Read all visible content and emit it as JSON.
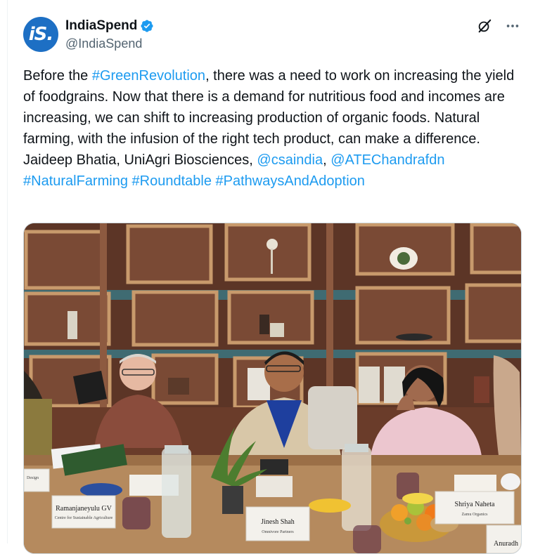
{
  "account": {
    "avatar_text": "iS.",
    "display_name": "IndiaSpend",
    "handle": "@IndiaSpend",
    "verified_icon": "verified-badge-icon",
    "brand_color": "#1d6fc4"
  },
  "actions": {
    "grok_icon": "grok-icon",
    "more_icon": "more-options-icon"
  },
  "tweet": {
    "t1": "Before the ",
    "h1": "#GreenRevolution",
    "t2": ", there was a need to work on increasing the yield of foodgrains. Now that there is a demand for nutritious food and incomes are increasing, we can shift to increasing production of organic foods. Natural farming, with the infusion of the right tech product, can make a difference. Jaideep Bhatia, UniAgri Biosciences, ",
    "m1": "@csaindia",
    "t3": ", ",
    "m2": "@ATEChandrafdn",
    "t4": " ",
    "h2": "#NaturalFarming",
    "t5": " ",
    "h3": "#Roundtable",
    "t6": " ",
    "h4": "#PathwaysAndAdoption",
    "link_color": "#1d9bf0"
  },
  "photo": {
    "name_cards": {
      "c1_name": "Ramanjaneyulu GV",
      "c1_org": "Centre for Sustainable Agriculture",
      "c2_name": "Jinesh Shah",
      "c2_org": "Omnivore Partners",
      "c3_name": "Shriya Naheta",
      "c3_org": "Zamu Organics",
      "c4_name": "Anuradh",
      "c5_name": "Design"
    }
  }
}
